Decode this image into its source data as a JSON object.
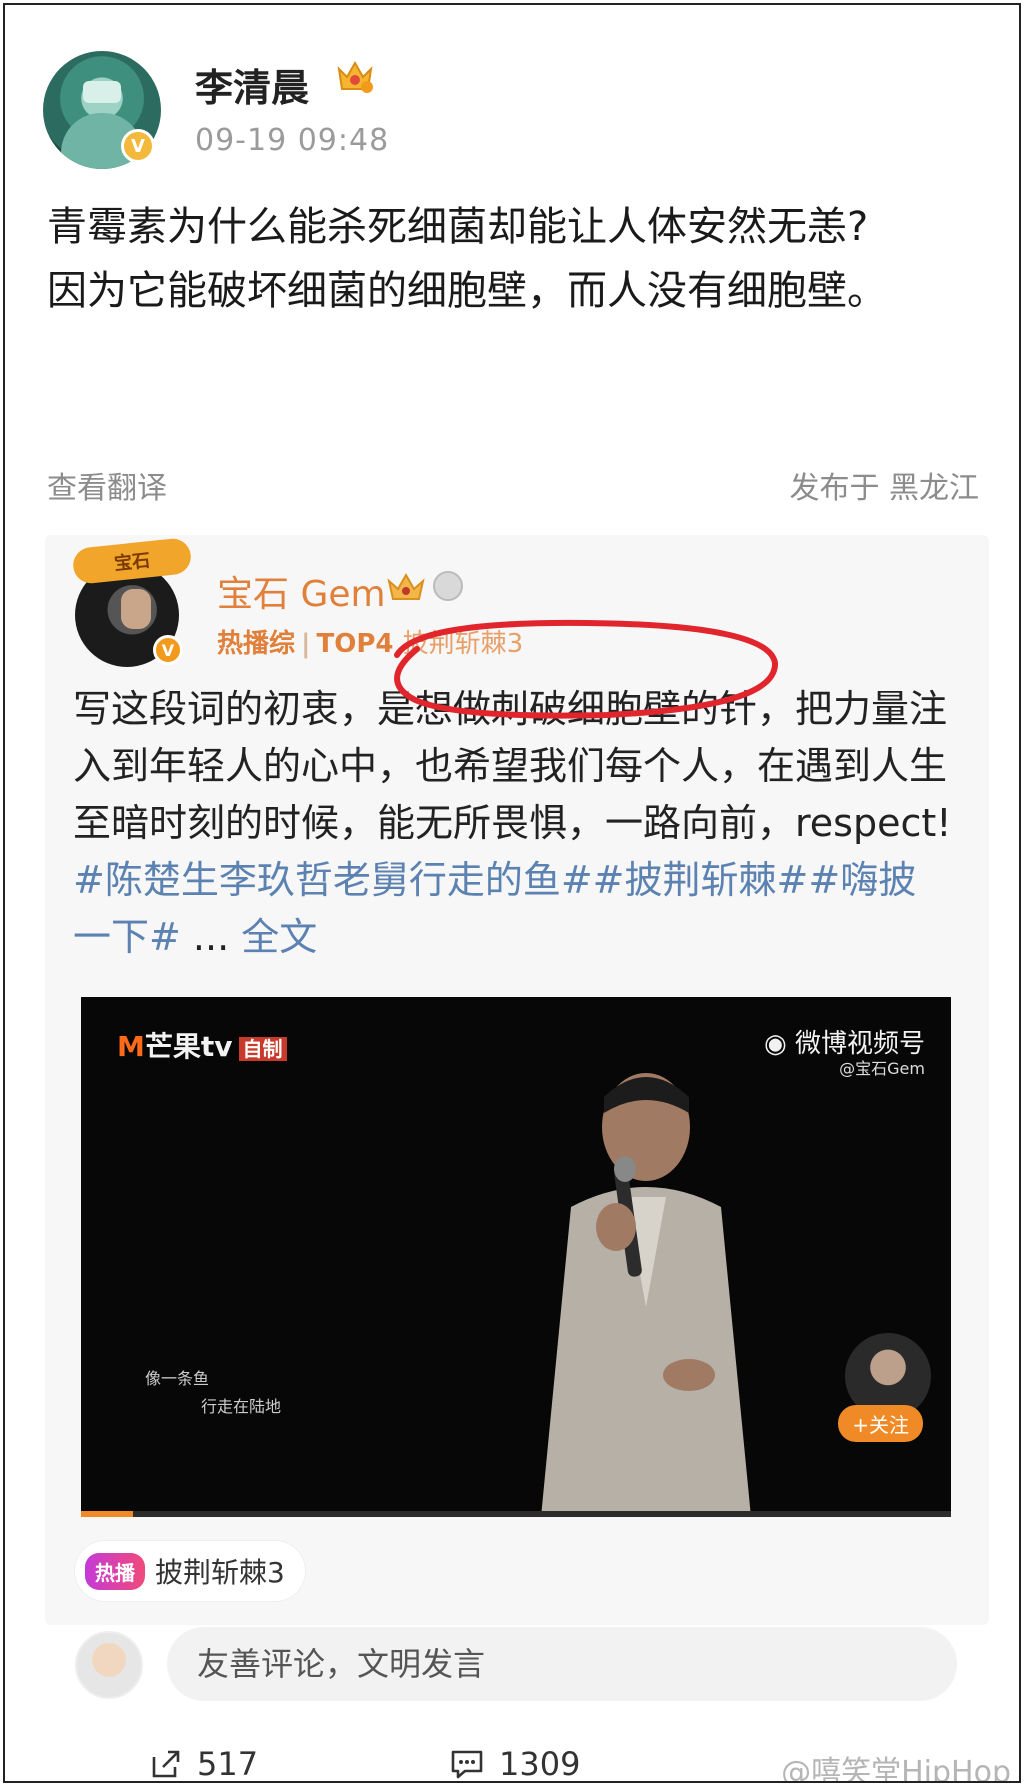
{
  "post": {
    "author": "李清晨",
    "verified_mark": "V",
    "time": "09-19 09:48",
    "text": "青霉素为什么能杀死细菌却能让人体安然无恙?\n因为它能破坏细菌的细胞壁，而人没有细胞壁。",
    "translate_label": "查看翻译",
    "location": "发布于 黑龙江"
  },
  "repost": {
    "author": "宝石 Gem",
    "avatar_tag": "宝石",
    "verified_mark": "V",
    "meta_tag": "热播综",
    "meta_rank": "TOP4",
    "meta_show": "披荆斩棘3",
    "text_plain": "写这段词的初衷，是想做刺破细胞壁的针，把力量注入到年轻人的心中，也希望我们每个人，在遇到人生至暗时刻的时候，能无所畏惧，一路向前，respect! ",
    "hashtags": "#陈楚生李玖哲老舅行走的鱼##披荆斩棘##嗨披一下#",
    "ellipsis": " ... ",
    "more_label": "全文",
    "video": {
      "brand": "芒果tv",
      "brand_m": "M",
      "brand_own": "自制",
      "weibo_label": "微博视频号",
      "weibo_handle": "@宝石Gem",
      "lyric_1": "像一条鱼",
      "lyric_2": "行走在陆地",
      "follow_label": "+关注",
      "progress": 0.06
    },
    "topic_chip": {
      "badge": "热播",
      "label": "披荆斩棘3"
    }
  },
  "comment": {
    "placeholder": "友善评论，文明发言"
  },
  "actions": {
    "repost_count": "517",
    "comment_count": "1309"
  },
  "watermark": "@嘻笑堂HipHop",
  "colors": {
    "accent_orange": "#e0803a",
    "link_blue": "#5b82b1",
    "highlight_red": "#e0262c"
  }
}
